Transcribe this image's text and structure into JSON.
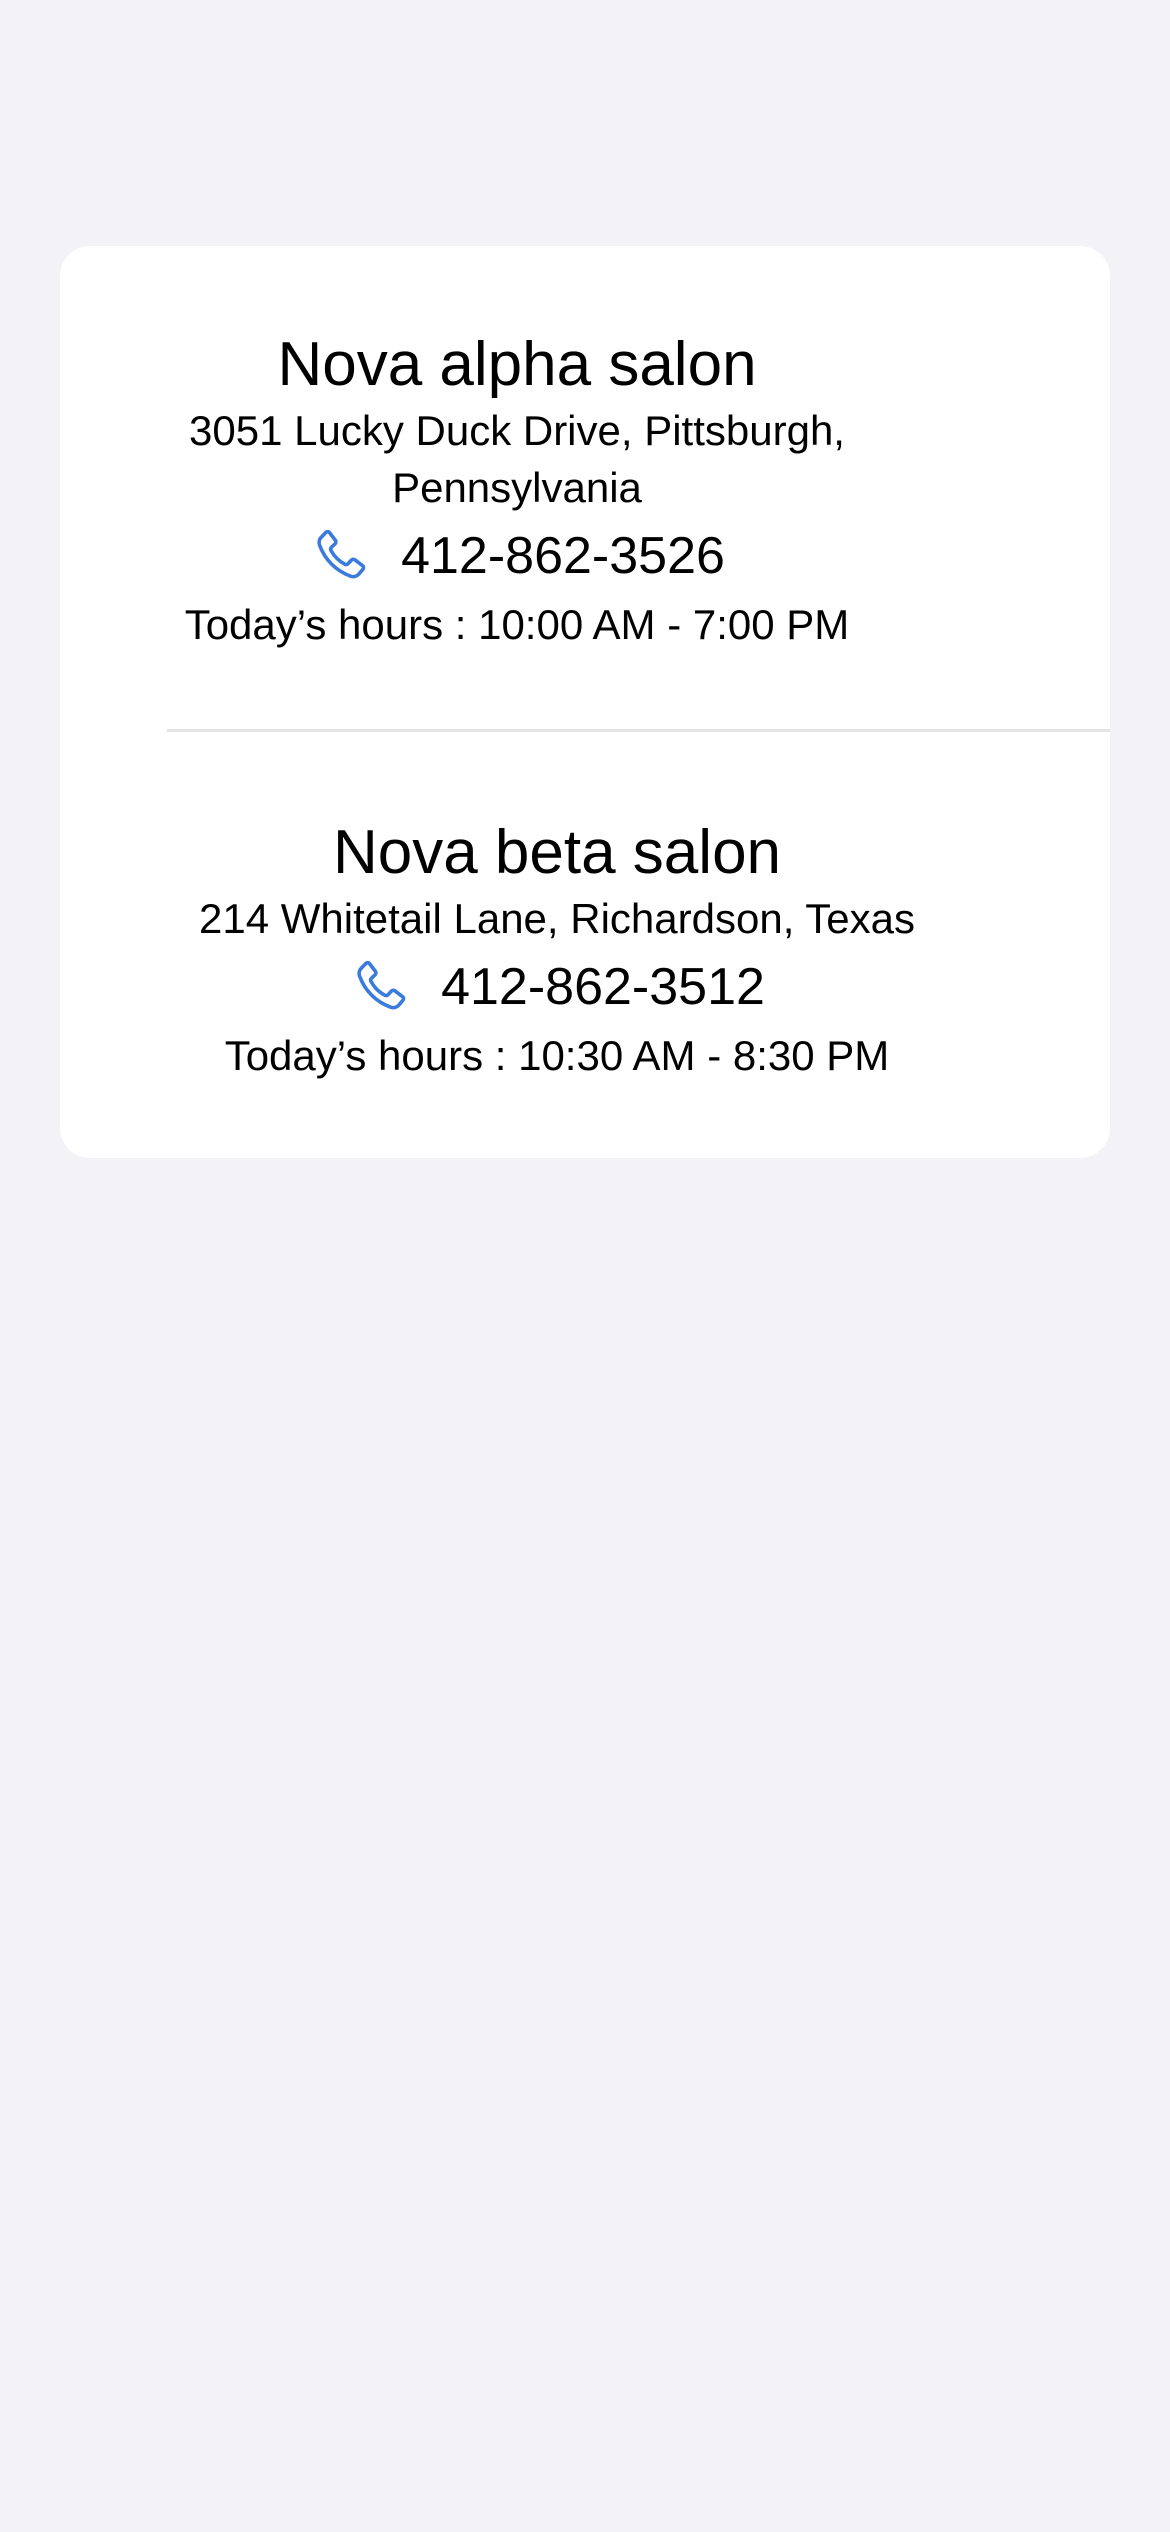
{
  "salons": [
    {
      "name": "Nova alpha salon",
      "address": "3051 Lucky Duck Drive, Pittsburgh, Pennsylvania",
      "phone": "412-862-3526",
      "hours": "Today’s hours : 10:00 AM - 7:00 PM",
      "phone_icon": "phone-icon"
    },
    {
      "name": "Nova beta salon",
      "address": "214 Whitetail Lane, Richardson, Texas",
      "phone": "412-862-3512",
      "hours": "Today’s hours : 10:30 AM - 8:30 PM",
      "phone_icon": "phone-icon"
    }
  ],
  "colors": {
    "background": "#f2f2f7",
    "card": "#ffffff",
    "accent": "#3a7bdc",
    "divider": "#e3e3e8"
  }
}
